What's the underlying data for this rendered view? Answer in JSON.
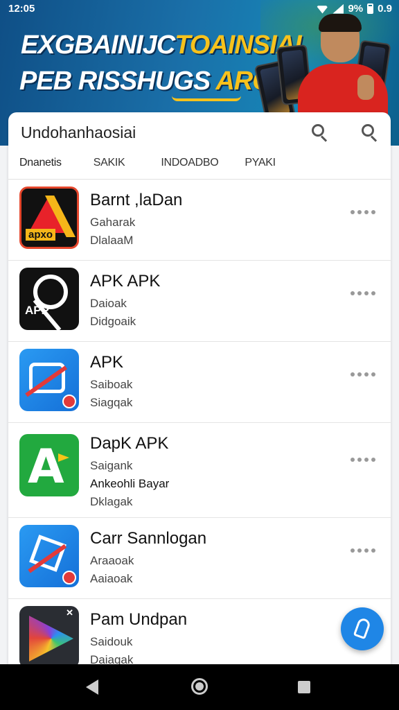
{
  "status_bar": {
    "time": "12:05",
    "battery": "9%",
    "extra": "0.9"
  },
  "banner": {
    "headline_line1_white": "EXGBAINIJC",
    "headline_line1_yellow": "TOAINSIAI",
    "headline_line2_white": "PEB RISSHUGS",
    "headline_line2_yellow": "ARC"
  },
  "search": {
    "title": "Undohanhaosiai"
  },
  "tabs": [
    "Dnanetis",
    "SAKIK",
    "INDOADBO",
    "PYAKI"
  ],
  "apps": [
    {
      "name": "Barnt ,laDan",
      "sub1": "Gaharak",
      "sub2": "DlalaaM",
      "sub3": "",
      "icon": "apk-red-yellow-a-icon",
      "icon_label": "apxo"
    },
    {
      "name": "APK APK",
      "sub1": "Daioak",
      "sub2": "Didgoaik",
      "sub3": "",
      "icon": "apk-black-ring-icon",
      "icon_label": "APP"
    },
    {
      "name": "APK",
      "sub1": "Saiboak",
      "sub2": "Siagqak",
      "sub3": "",
      "icon": "apk-blue-bubble-icon",
      "icon_label": ""
    },
    {
      "name": "DapK APK",
      "sub1": "Saigank",
      "sub2": "Ankeohli Bayar",
      "sub3": "Dklagak",
      "icon": "apk-green-a-icon",
      "icon_label": ""
    },
    {
      "name": "Carr Sannlogan",
      "sub1": "Araaoak",
      "sub2": "Aaiaoak",
      "sub3": "",
      "icon": "apk-blue-square-icon",
      "icon_label": ""
    },
    {
      "name": "Pam Undpan",
      "sub1": "Saidouk",
      "sub2": "Daiagak",
      "sub3": "",
      "icon": "apk-play-icon",
      "icon_label": ""
    }
  ],
  "colors": {
    "banner_blue": "#1a6fa8",
    "accent_yellow": "#f7c21c",
    "fab_blue": "#1f86e6"
  }
}
